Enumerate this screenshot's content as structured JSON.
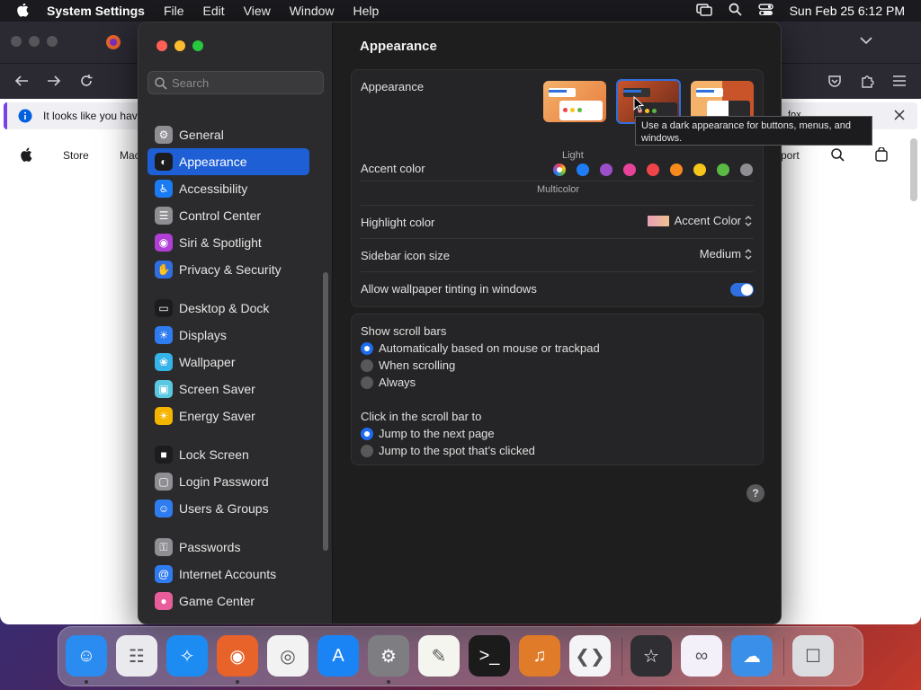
{
  "menubar": {
    "app_name": "System Settings",
    "items": [
      "File",
      "Edit",
      "View",
      "Window",
      "Help"
    ],
    "clock": "Sun Feb 25  6:12 PM"
  },
  "browser": {
    "notice_text": "It looks like you have",
    "notice_tail": "fox",
    "nav_links": [
      "Store",
      "Mac",
      "port"
    ]
  },
  "settings": {
    "search_placeholder": "Search",
    "sidebar": [
      {
        "label": "General",
        "color": "#8e8e93",
        "group": 0
      },
      {
        "label": "Appearance",
        "color": "#1c1c1e",
        "group": 0,
        "active": true
      },
      {
        "label": "Accessibility",
        "color": "#1a7bf2",
        "group": 0
      },
      {
        "label": "Control Center",
        "color": "#8e8e93",
        "group": 0
      },
      {
        "label": "Siri & Spotlight",
        "color": "#b13fd6",
        "group": 0
      },
      {
        "label": "Privacy & Security",
        "color": "#2f6fe0",
        "group": 0
      },
      {
        "label": "Desktop & Dock",
        "color": "#1c1c1e",
        "group": 1
      },
      {
        "label": "Displays",
        "color": "#2f7bf0",
        "group": 1
      },
      {
        "label": "Wallpaper",
        "color": "#36b3e8",
        "group": 1
      },
      {
        "label": "Screen Saver",
        "color": "#5ac8e0",
        "group": 1
      },
      {
        "label": "Energy Saver",
        "color": "#f5b400",
        "group": 1
      },
      {
        "label": "Lock Screen",
        "color": "#1c1c1e",
        "group": 2
      },
      {
        "label": "Login Password",
        "color": "#8e8e93",
        "group": 2
      },
      {
        "label": "Users & Groups",
        "color": "#2f7bf0",
        "group": 2
      },
      {
        "label": "Passwords",
        "color": "#8e8e93",
        "group": 3
      },
      {
        "label": "Internet Accounts",
        "color": "#2f7bf0",
        "group": 3
      },
      {
        "label": "Game Center",
        "color": "#e85d9a",
        "group": 3
      }
    ],
    "page_title": "Appearance",
    "appearance": {
      "label": "Appearance",
      "light_label": "Light",
      "tooltip": "Use a dark appearance for buttons, menus, and windows."
    },
    "accent": {
      "label": "Accent color",
      "multicolor_label": "Multicolor",
      "colors": [
        "#1f7cf5",
        "#9b4fc8",
        "#e8439a",
        "#f0444b",
        "#f78a1d",
        "#f7c61c",
        "#5bb846",
        "#8e8e93"
      ]
    },
    "highlight": {
      "label": "Highlight color",
      "value": "Accent Color"
    },
    "sidebar_icon_size": {
      "label": "Sidebar icon size",
      "value": "Medium"
    },
    "wallpaper_tinting": {
      "label": "Allow wallpaper tinting in windows",
      "enabled": true
    },
    "scroll_bars": {
      "label": "Show scroll bars",
      "options": [
        "Automatically based on mouse or trackpad",
        "When scrolling",
        "Always"
      ],
      "selected": 0
    },
    "click_scroll": {
      "label": "Click in the scroll bar to",
      "options": [
        "Jump to the next page",
        "Jump to the spot that’s clicked"
      ],
      "selected": 0
    },
    "help": "?"
  },
  "dock": {
    "apps": [
      {
        "name": "finder",
        "color": "#2a8cf0",
        "running": true
      },
      {
        "name": "launchpad",
        "color": "#e9e9ee",
        "running": false
      },
      {
        "name": "safari",
        "color": "#1c8cf2",
        "running": false
      },
      {
        "name": "firefox",
        "color": "#e8632a",
        "running": true
      },
      {
        "name": "chrome",
        "color": "#f2f2f2",
        "running": false
      },
      {
        "name": "app-store",
        "color": "#1a84f5",
        "running": false
      },
      {
        "name": "system-settings",
        "color": "#7d7d82",
        "running": true
      },
      {
        "name": "textedit",
        "color": "#f5f5f0",
        "running": false
      },
      {
        "name": "terminal",
        "color": "#1b1b1b",
        "running": false
      },
      {
        "name": "garageband",
        "color": "#e07b2a",
        "running": false
      },
      {
        "name": "vscode",
        "color": "#f4f4f6",
        "running": false
      },
      {
        "name": "alfred",
        "color": "#2e2e33",
        "running": false
      },
      {
        "name": "visual-studio",
        "color": "#f4f0fa",
        "running": false
      },
      {
        "name": "weather",
        "color": "#3a8fe8",
        "running": false
      },
      {
        "name": "trash",
        "color": "#dcdde0",
        "running": false
      }
    ]
  }
}
